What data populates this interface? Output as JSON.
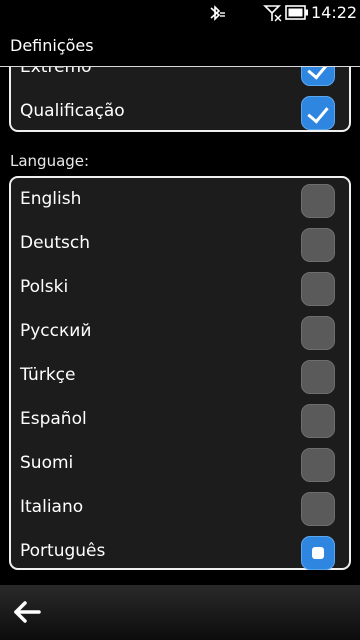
{
  "status": {
    "time": "14:22"
  },
  "header": {
    "title": "Definições"
  },
  "upper_list": [
    {
      "label": "Extremo",
      "checked": true
    },
    {
      "label": "Qualificação",
      "checked": true
    }
  ],
  "language_section": {
    "label": "Language:",
    "options": [
      {
        "label": "English",
        "selected": false
      },
      {
        "label": "Deutsch",
        "selected": false
      },
      {
        "label": "Polski",
        "selected": false
      },
      {
        "label": "Русский",
        "selected": false
      },
      {
        "label": "Türkçe",
        "selected": false
      },
      {
        "label": "Español",
        "selected": false
      },
      {
        "label": "Suomi",
        "selected": false
      },
      {
        "label": "Italiano",
        "selected": false
      },
      {
        "label": "Português",
        "selected": true
      }
    ]
  },
  "toolbar": {
    "back_icon": "back-arrow-icon"
  },
  "colors": {
    "accent": "#2e86e0",
    "card_bg": "#1c1c1c",
    "card_border": "#f0f0f0"
  }
}
